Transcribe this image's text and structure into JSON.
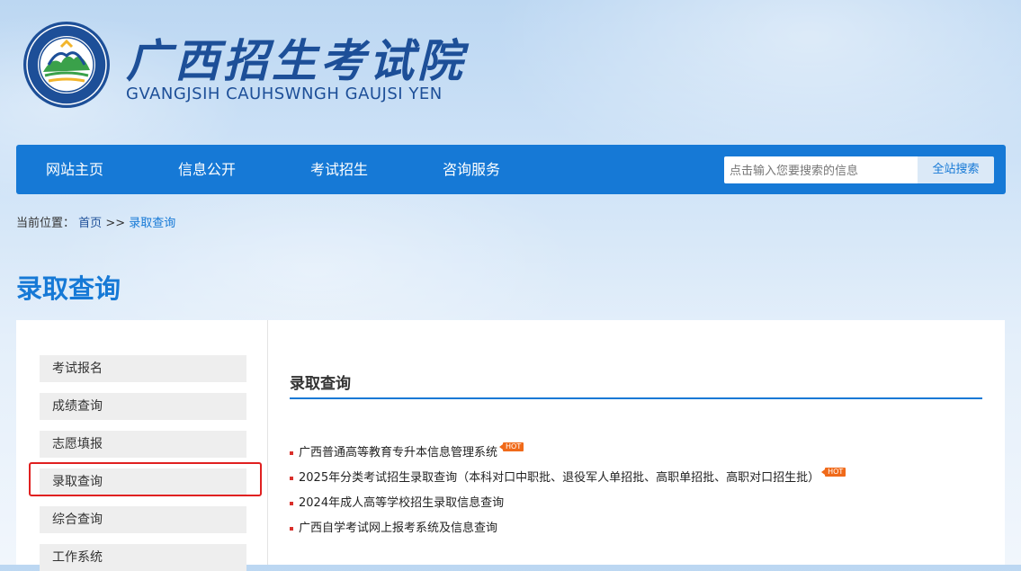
{
  "header": {
    "logo_cn": "广西招生考试院",
    "logo_en": "GVANGJSIH CAUHSWNGH GAUJSI YEN",
    "emblem_ring_text": "广西招生考试院 GVANGJSIH CAUHSWNGH GAUJSI YEN"
  },
  "nav": {
    "items": [
      {
        "label": "网站主页"
      },
      {
        "label": "信息公开"
      },
      {
        "label": "考试招生"
      },
      {
        "label": "咨询服务"
      }
    ],
    "search_placeholder": "点击输入您要搜索的信息",
    "search_button": "全站搜索"
  },
  "breadcrumb": {
    "prefix": "当前位置：",
    "home": "首页",
    "separator": ">>",
    "current": "录取查询"
  },
  "page_title": "录取查询",
  "sidebar": {
    "items": [
      {
        "label": "考试报名"
      },
      {
        "label": "成绩查询"
      },
      {
        "label": "志愿填报"
      },
      {
        "label": "录取查询"
      },
      {
        "label": "综合查询"
      },
      {
        "label": "工作系统"
      }
    ]
  },
  "content": {
    "title": "录取查询",
    "hot_label": "HOT",
    "links": [
      {
        "text": "广西普通高等教育专升本信息管理系统",
        "hot": true
      },
      {
        "text": "2025年分类考试招生录取查询（本科对口中职批、退役军人单招批、高职单招批、高职对口招生批）",
        "hot": true
      },
      {
        "text": "2024年成人高等学校招生录取信息查询",
        "hot": false
      },
      {
        "text": "广西自学考试网上报考系统及信息查询",
        "hot": false
      }
    ]
  },
  "colors": {
    "primary": "#1679d6",
    "title_blue": "#1d4f98",
    "highlight_red": "#e02020",
    "hot_orange": "#f06a1a"
  }
}
